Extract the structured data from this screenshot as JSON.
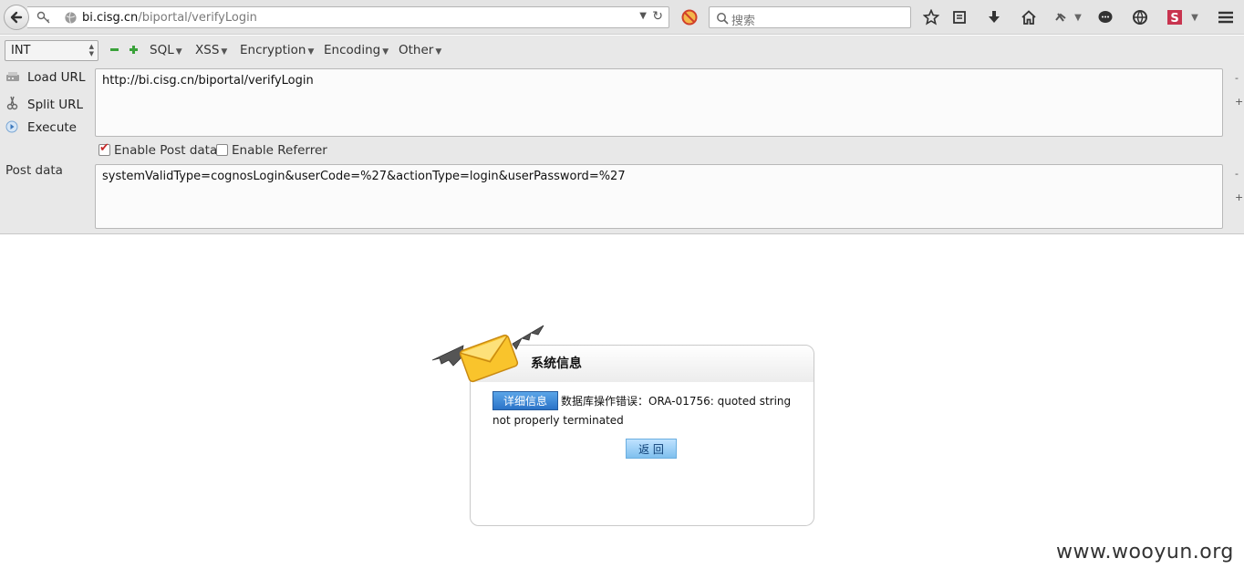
{
  "browser": {
    "url_host": "bi.cisg.cn",
    "url_path": "/biportal/verifyLogin",
    "search_placeholder": "搜索"
  },
  "hackbar": {
    "type_select": "INT",
    "menus": {
      "sql": "SQL",
      "xss": "XSS",
      "encryption": "Encryption",
      "encoding": "Encoding",
      "other": "Other"
    },
    "load_url": "Load URL",
    "split_url": "Split URL",
    "execute": "Execute",
    "url_value": "http://bi.cisg.cn/biportal/verifyLogin",
    "enable_post": "Enable Post data",
    "enable_referrer": "Enable Referrer",
    "post_label": "Post data",
    "post_value": "systemValidType=cognosLogin&userCode=%27&actionType=login&userPassword=%27",
    "minus": "-",
    "plus": "+"
  },
  "dialog": {
    "title": "系统信息",
    "detail_button": "详细信息",
    "message": "数据库操作错误：ORA-01756: quoted string not properly terminated",
    "return_button": "返 回"
  },
  "watermark": "www.wooyun.org",
  "colors": {
    "toolbar_bg": "#e4e4e4",
    "detail_button": "#2b73c8",
    "return_button": "#7fc0ee",
    "checkbox_mark": "#c62a2a"
  }
}
